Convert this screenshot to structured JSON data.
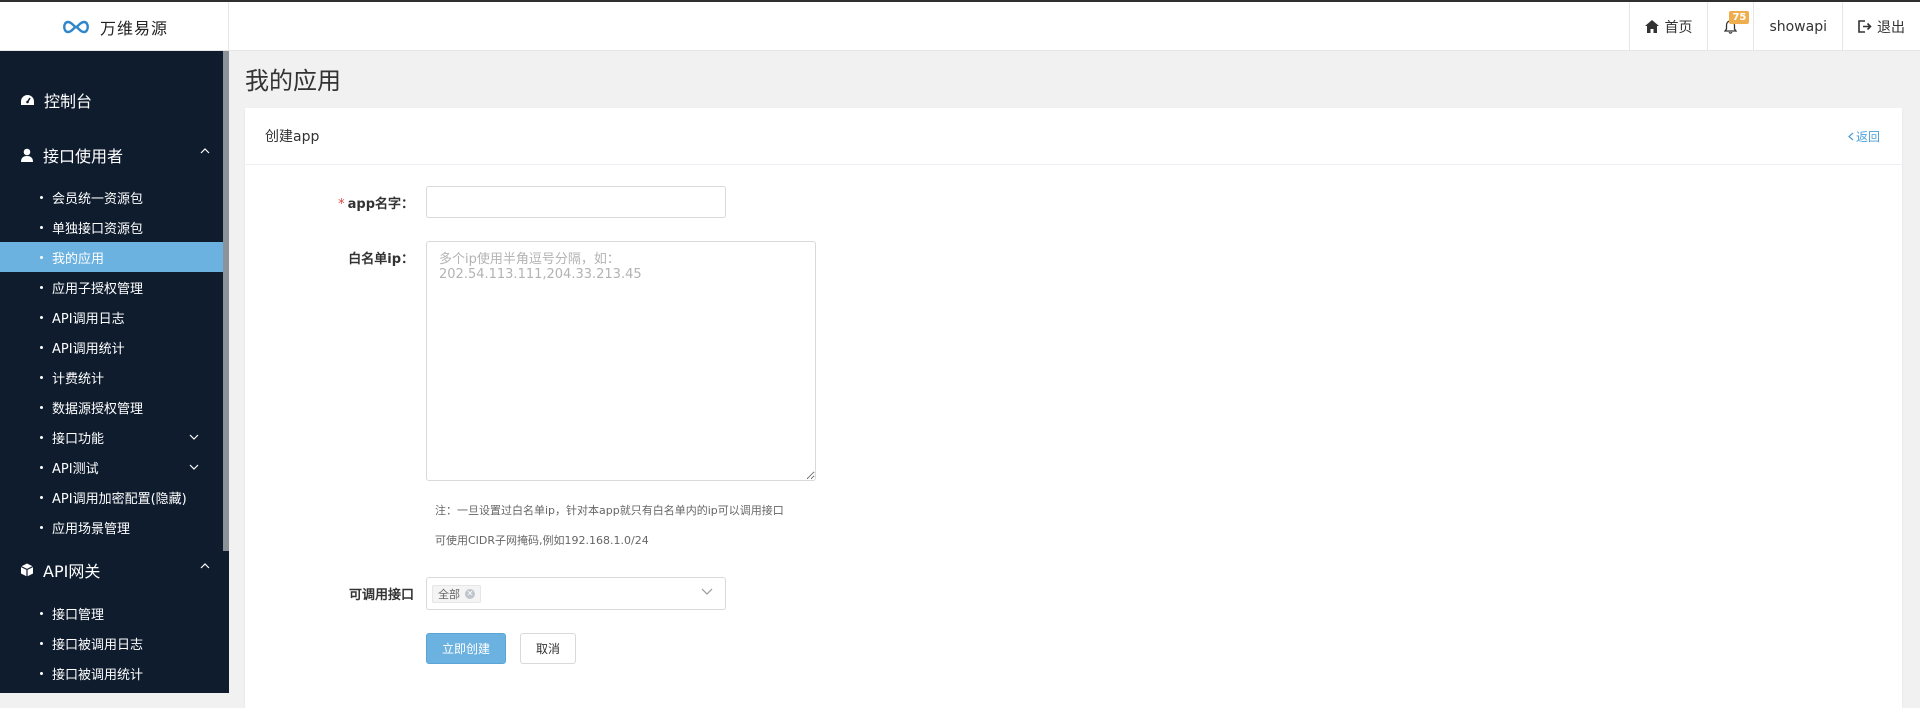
{
  "brand": {
    "name": "万维易源"
  },
  "topnav": {
    "home_label": "首页",
    "notif_count": "75",
    "username": "showapi",
    "logout_label": "退出"
  },
  "sidebar": {
    "dashboard": "控制台",
    "group_user": "接口使用者",
    "user_items": [
      "会员统一资源包",
      "单独接口资源包",
      "我的应用",
      "应用子授权管理",
      "API调用日志",
      "API调用统计",
      "计费统计",
      "数据源授权管理",
      "接口功能",
      "API测试",
      "API调用加密配置(隐藏)",
      "应用场景管理"
    ],
    "group_gateway": "API网关",
    "gateway_items": [
      "接口管理",
      "接口被调用日志",
      "接口被调用统计"
    ]
  },
  "page": {
    "title": "我的应用",
    "card_title": "创建app",
    "back_label": "返回"
  },
  "form": {
    "app_name_label": "app名字：",
    "app_name_required": "*",
    "app_name_value": "",
    "whitelist_label": "白名单ip：",
    "whitelist_placeholder": "多个ip使用半角逗号分隔，如：202.54.113.111,204.33.213.45",
    "note_1": "注：一旦设置过白名单ip，针对本app就只有白名单内的ip可以调用接口",
    "note_2": "可使用CIDR子网掩码,例如192.168.1.0/24",
    "api_label": "可调用接口",
    "api_tag": "全部",
    "submit_label": "立即创建",
    "cancel_label": "取消"
  },
  "colors": {
    "sidebar_bg": "#0f1c2e",
    "accent": "#6cb2e0",
    "badge": "#f0ad4e",
    "required": "#e0443a"
  }
}
